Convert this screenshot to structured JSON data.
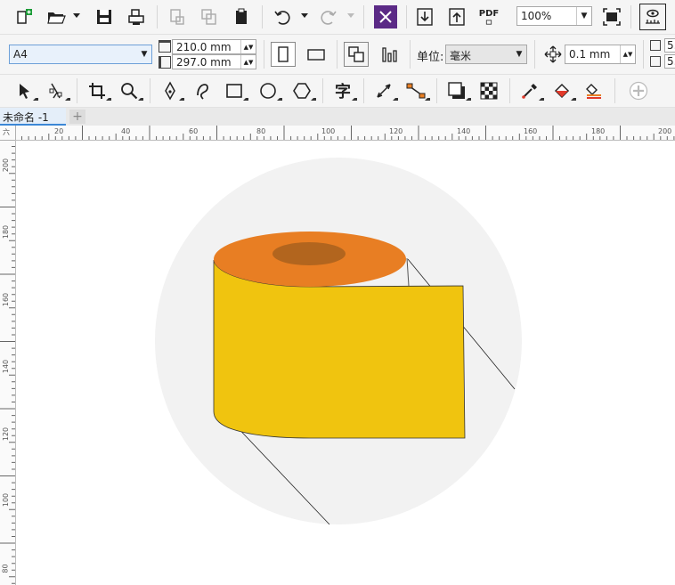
{
  "zoom": "100%",
  "paper_size": "A4",
  "page_width": "210.0 mm",
  "page_height": "297.0 mm",
  "units_label": "单位:",
  "units_value": "毫米",
  "nudge": "0.1 mm",
  "dup_x_partial": "5.",
  "dup_y_partial": "5.",
  "pdf_label": "PDF",
  "text_tool_glyph": "字",
  "document_tab": "未命名 -1",
  "ruler": {
    "corner_glyph": "六",
    "h_labels": [
      "20",
      "40",
      "60",
      "80",
      "100",
      "120",
      "140",
      "160",
      "180",
      "200"
    ],
    "v_labels": [
      "200",
      "180",
      "160",
      "140",
      "120",
      "100",
      "80"
    ]
  },
  "colors": {
    "roll_body": "#F0C40F",
    "roll_top": "#E87E23",
    "roll_hole": "#B2651E",
    "backdrop": "#F2F2F2",
    "accent_purple": "#5B2A86"
  }
}
